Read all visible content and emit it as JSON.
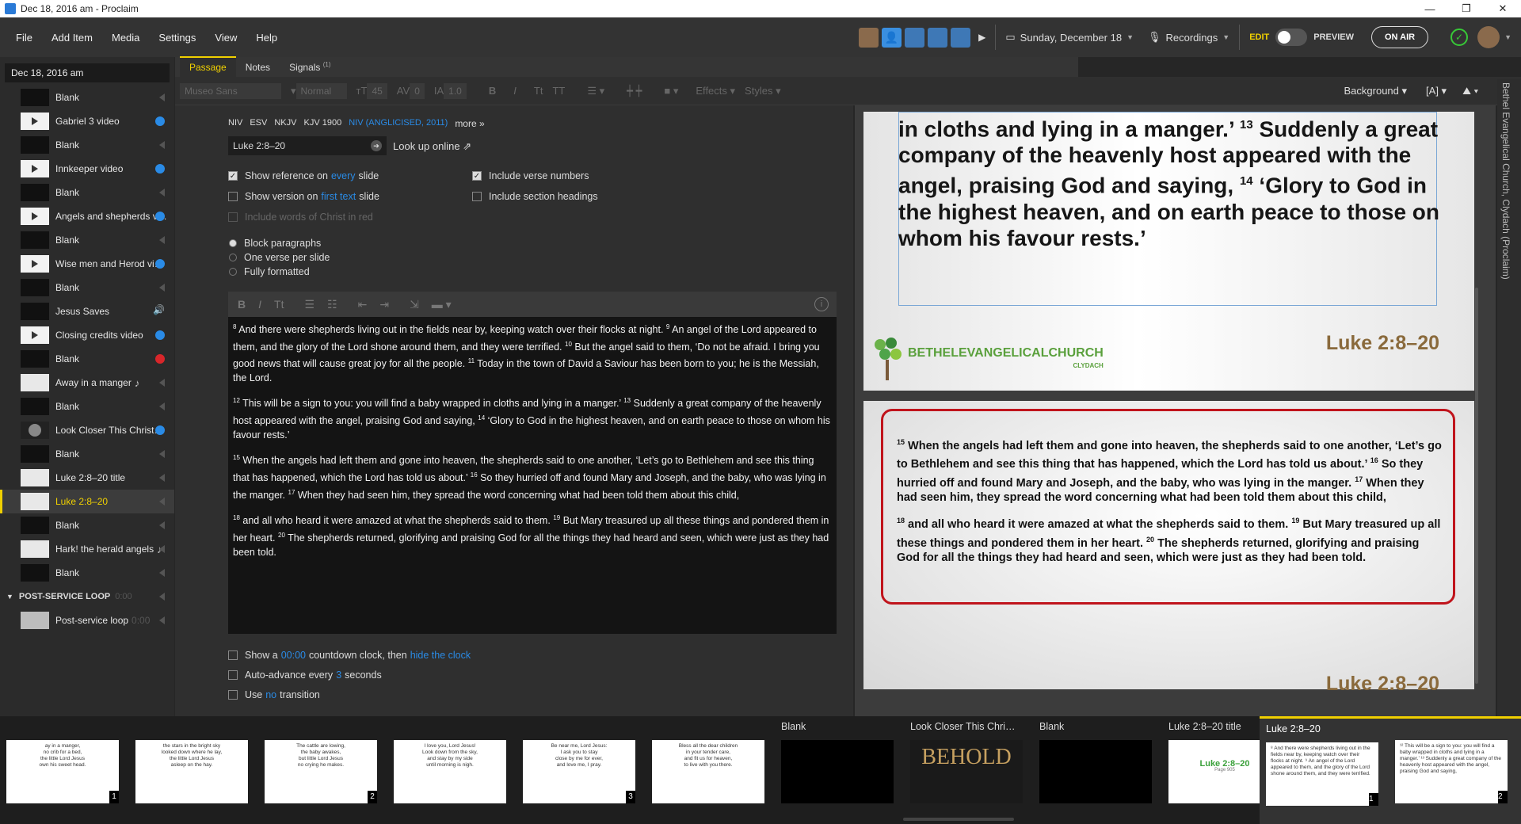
{
  "window": {
    "title": "Dec 18, 2016 am - Proclaim"
  },
  "menu": {
    "items": [
      "File",
      "Add Item",
      "Media",
      "Settings",
      "View",
      "Help"
    ]
  },
  "toolbar": {
    "date": "Sunday, December 18",
    "recordings": "Recordings",
    "edit_label": "EDIT",
    "preview_label": "PREVIEW",
    "on_air_label": "ON AIR"
  },
  "sidebar": {
    "title": "Dec 18, 2016 am",
    "items": [
      {
        "label": "Blank",
        "thumb": "black",
        "status": "mute"
      },
      {
        "label": "Gabriel 3 video",
        "thumb": "video",
        "status": "play"
      },
      {
        "label": "Blank",
        "thumb": "black",
        "status": "mute"
      },
      {
        "label": "Innkeeper video",
        "thumb": "video",
        "status": "play"
      },
      {
        "label": "Blank",
        "thumb": "black",
        "status": "mute"
      },
      {
        "label": "Angels and shepherds v…",
        "thumb": "video",
        "status": "play"
      },
      {
        "label": "Blank",
        "thumb": "black",
        "status": "mute"
      },
      {
        "label": "Wise men and Herod vi…",
        "thumb": "video",
        "status": "play"
      },
      {
        "label": "Blank",
        "thumb": "black",
        "status": "mute"
      },
      {
        "label": "Jesus Saves",
        "thumb": "black",
        "status": "volume"
      },
      {
        "label": "Closing credits video",
        "thumb": "video",
        "status": "play"
      },
      {
        "label": "Blank",
        "thumb": "black",
        "status": "red"
      },
      {
        "label": "Away in a manger",
        "thumb": "light",
        "status": "mute",
        "note": "♪"
      },
      {
        "label": "Blank",
        "thumb": "black",
        "status": "mute"
      },
      {
        "label": "Look Closer This Christ…",
        "thumb": "look",
        "status": "play"
      },
      {
        "label": "Blank",
        "thumb": "black",
        "status": "mute"
      },
      {
        "label": "Luke 2:8–20 title",
        "thumb": "light",
        "status": "mute"
      },
      {
        "label": "Luke 2:8–20",
        "thumb": "light",
        "status": "mute",
        "active": true
      },
      {
        "label": "Blank",
        "thumb": "black",
        "status": "mute"
      },
      {
        "label": "Hark! the herald angels",
        "thumb": "light",
        "status": "mute",
        "note": "♪"
      },
      {
        "label": "Blank",
        "thumb": "black",
        "status": "mute"
      }
    ],
    "section": {
      "label": "POST-SERVICE LOOP",
      "duration": "0:00"
    },
    "post_item": {
      "label": "Post-service loop",
      "duration": "0:00"
    }
  },
  "tabs": {
    "passage": "Passage",
    "notes": "Notes",
    "signals": "Signals",
    "signals_count": "(1)"
  },
  "format": {
    "font": "Museo Sans",
    "weight": "Normal",
    "size": "45",
    "spacing": "0",
    "line": "1.0",
    "effects": "Effects",
    "styles": "Styles",
    "background": "Background"
  },
  "passage": {
    "versions": [
      "NIV",
      "ESV",
      "NKJV",
      "KJV 1900"
    ],
    "selected_version": "NIV (ANGLICISED, 2011)",
    "more": "more »",
    "reference": "Luke 2:8–20",
    "look_up": "Look up online",
    "opt_show_ref_pre": "Show reference on",
    "opt_show_ref_link": "every",
    "opt_show_ref_post": "slide",
    "opt_show_ver_pre": "Show version on",
    "opt_show_ver_link": "first text",
    "opt_show_ver_post": "slide",
    "opt_words_christ": "Include words of Christ in red",
    "opt_verse_numbers": "Include verse numbers",
    "opt_section_headings": "Include section headings",
    "radio_block": "Block paragraphs",
    "radio_verse": "One verse per slide",
    "radio_formatted": "Fully formatted",
    "text": [
      [
        [
          "8",
          "And there were shepherds living out in the fields near by, keeping watch over their flocks at night."
        ],
        [
          "9",
          "An angel of the Lord appeared to them, and the glory of the Lord shone around them, and they were terrified."
        ],
        [
          "10",
          "But the angel said to them, ‘Do not be afraid. I bring you good news that will cause great joy for all the people."
        ],
        [
          "11",
          "Today in the town of David a Saviour has been born to you; he is the Messiah, the Lord."
        ]
      ],
      [
        [
          "12",
          "This will be a sign to you: you will find a baby wrapped in cloths and lying in a manger.’"
        ],
        [
          "13",
          "Suddenly a great company of the heavenly host appeared with the angel, praising God and saying,"
        ],
        [
          "14",
          "‘Glory to God in the highest heaven, and on earth peace to those on whom his favour rests.’"
        ]
      ],
      [
        [
          "15",
          "When the angels had left them and gone into heaven, the shepherds said to one another, ‘Let’s go to Bethlehem and see this thing that has happened, which the Lord has told us about.’"
        ],
        [
          "16",
          "So they hurried off and found Mary and Joseph, and the baby, who was lying in the manger."
        ],
        [
          "17",
          "When they had seen him, they spread the word concerning what had been told them about this child,"
        ]
      ],
      [
        [
          "18",
          "and all who heard it were amazed at what the shepherds said to them."
        ],
        [
          "19",
          "But Mary treasured up all these things and pondered them in her heart."
        ],
        [
          "20",
          "The shepherds returned, glorifying and praising God for all the things they had heard and seen, which were just as they had been told."
        ]
      ]
    ],
    "countdown_pre": "Show a",
    "countdown_time": "00:00",
    "countdown_mid": "countdown clock, then",
    "countdown_link": "hide the clock",
    "advance_pre": "Auto-advance every",
    "advance_num": "3",
    "advance_post": "seconds",
    "transition_pre": "Use",
    "transition_link": "no",
    "transition_post": "transition"
  },
  "preview": {
    "slide1_text": "in cloths and lying in a manger.’ 13 Suddenly a great company of the heavenly host appeared with the angel, praising God and saying, 14 ‘Glory to God in the highest heaven, and on earth peace to those on whom his favour rests.’",
    "slide_ref": "Luke 2:8–20",
    "church_name": "BETHELEVANGELICALCHURCH",
    "church_sub": "CLYDACH",
    "vertical_label": "Bethel Evangelical Church, Clydach (Proclaim)"
  },
  "strip": [
    {
      "title": "",
      "text": "ay in a manger,\nno crib for a bed,\nthe little Lord Jesus\nown his sweet head.",
      "num": "1"
    },
    {
      "title": "",
      "text": "the stars in the bright sky\nlooked down where he lay,\nthe little Lord Jesus\nasleep on the hay.",
      "num": ""
    },
    {
      "title": "",
      "text": "The cattle are lowing,\nthe baby awakes,\nbut little Lord Jesus\nno crying he makes.",
      "num": "2"
    },
    {
      "title": "",
      "text": "I love you, Lord Jesus!\nLook down from the sky,\nand stay by my side\nuntil morning is nigh.",
      "num": ""
    },
    {
      "title": "",
      "text": "Be near me, Lord Jesus:\nI ask you to stay\nclose by me for ever,\nand love me, I pray.",
      "num": "3"
    },
    {
      "title": "",
      "text": "Bless all the dear children\nin your tender care,\nand fit us for heaven,\nto live with you there.",
      "num": ""
    },
    {
      "title": "Blank",
      "text": "",
      "num": "",
      "black": true
    },
    {
      "title": "Look Closer This Chri…",
      "text": "BEHOLD",
      "num": "",
      "behold": true
    },
    {
      "title": "Blank",
      "text": "",
      "num": "",
      "black": true
    },
    {
      "title": "Luke 2:8–20 title",
      "text": "Luke 2:8–20",
      "sub": "Page 905",
      "num": "",
      "titlecard": true
    },
    {
      "title": "Luke 2:8–20",
      "text": "⁸ And there were shepherds living out in the fields near by, keeping watch over their flocks at night. ⁹ An angel of the Lord appeared to them, and the glory of the Lord shone around them, and they were terrified.",
      "num": "1",
      "active": true
    },
    {
      "title": "",
      "text": "¹² This will be a sign to you: you will find a baby wrapped in cloths and lying in a manger.’ ¹³ Suddenly a great company of the heavenly host appeared with the angel, praising God and saying,",
      "num": "2",
      "active": true
    }
  ]
}
